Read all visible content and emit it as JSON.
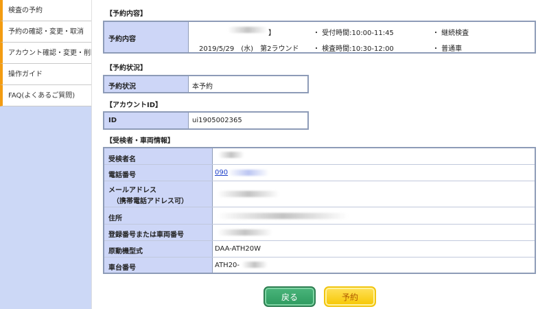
{
  "sidebar": {
    "items": [
      {
        "label": "検査の予約"
      },
      {
        "label": "予約の確認・変更・取消"
      },
      {
        "label": "アカウント確認・変更・削除"
      },
      {
        "label": "操作ガイド"
      },
      {
        "label": "FAQ(よくあるご質問)"
      }
    ]
  },
  "reservation": {
    "section_title": "【予約内容】",
    "header": "予約内容",
    "line1_suffix": "】",
    "date_round": "2019/5/29　(水)　第2ラウンド",
    "reception_time": "・ 受付時間:10:00-11:45",
    "inspection_time": "・ 検査時間:10:30-12:00",
    "type1": "・ 継続検査",
    "type2": "・ 普通車"
  },
  "status": {
    "section_title": "【予約状況】",
    "header": "予約状況",
    "value": "本予約"
  },
  "account": {
    "section_title": "【アカウントID】",
    "header": "ID",
    "value": "ui1905002365"
  },
  "applicant": {
    "section_title": "【受検者・車両情報】",
    "rows": [
      {
        "label": "受検者名",
        "value": ""
      },
      {
        "label": "電話番号",
        "value": "090"
      },
      {
        "label": "メールアドレス",
        "label2": "（携帯電話アドレス可）",
        "value": ""
      },
      {
        "label": "住所",
        "value": ""
      },
      {
        "label": "登録番号または車両番号",
        "value": ""
      },
      {
        "label": "原動機型式",
        "value": "DAA-ATH20W"
      },
      {
        "label": "車台番号",
        "value": "ATH20-"
      }
    ]
  },
  "buttons": {
    "back": "戻る",
    "reserve": "予約"
  }
}
